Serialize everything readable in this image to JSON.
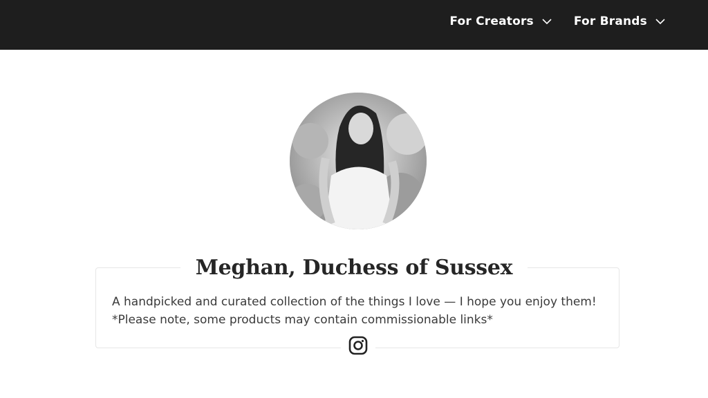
{
  "nav": {
    "items": [
      {
        "label": "For Creators"
      },
      {
        "label": "For Brands"
      }
    ]
  },
  "profile": {
    "name": "Meghan, Duchess of Sussex",
    "bio": "A handpicked and curated collection of the things I love — I hope you enjoy them! *Please note, some products may contain commissionable links*",
    "social_icon": "instagram-icon"
  },
  "colors": {
    "topbar": "#1e1e1e",
    "text": "#2b2b2b",
    "card_border": "#e6e6e6"
  }
}
